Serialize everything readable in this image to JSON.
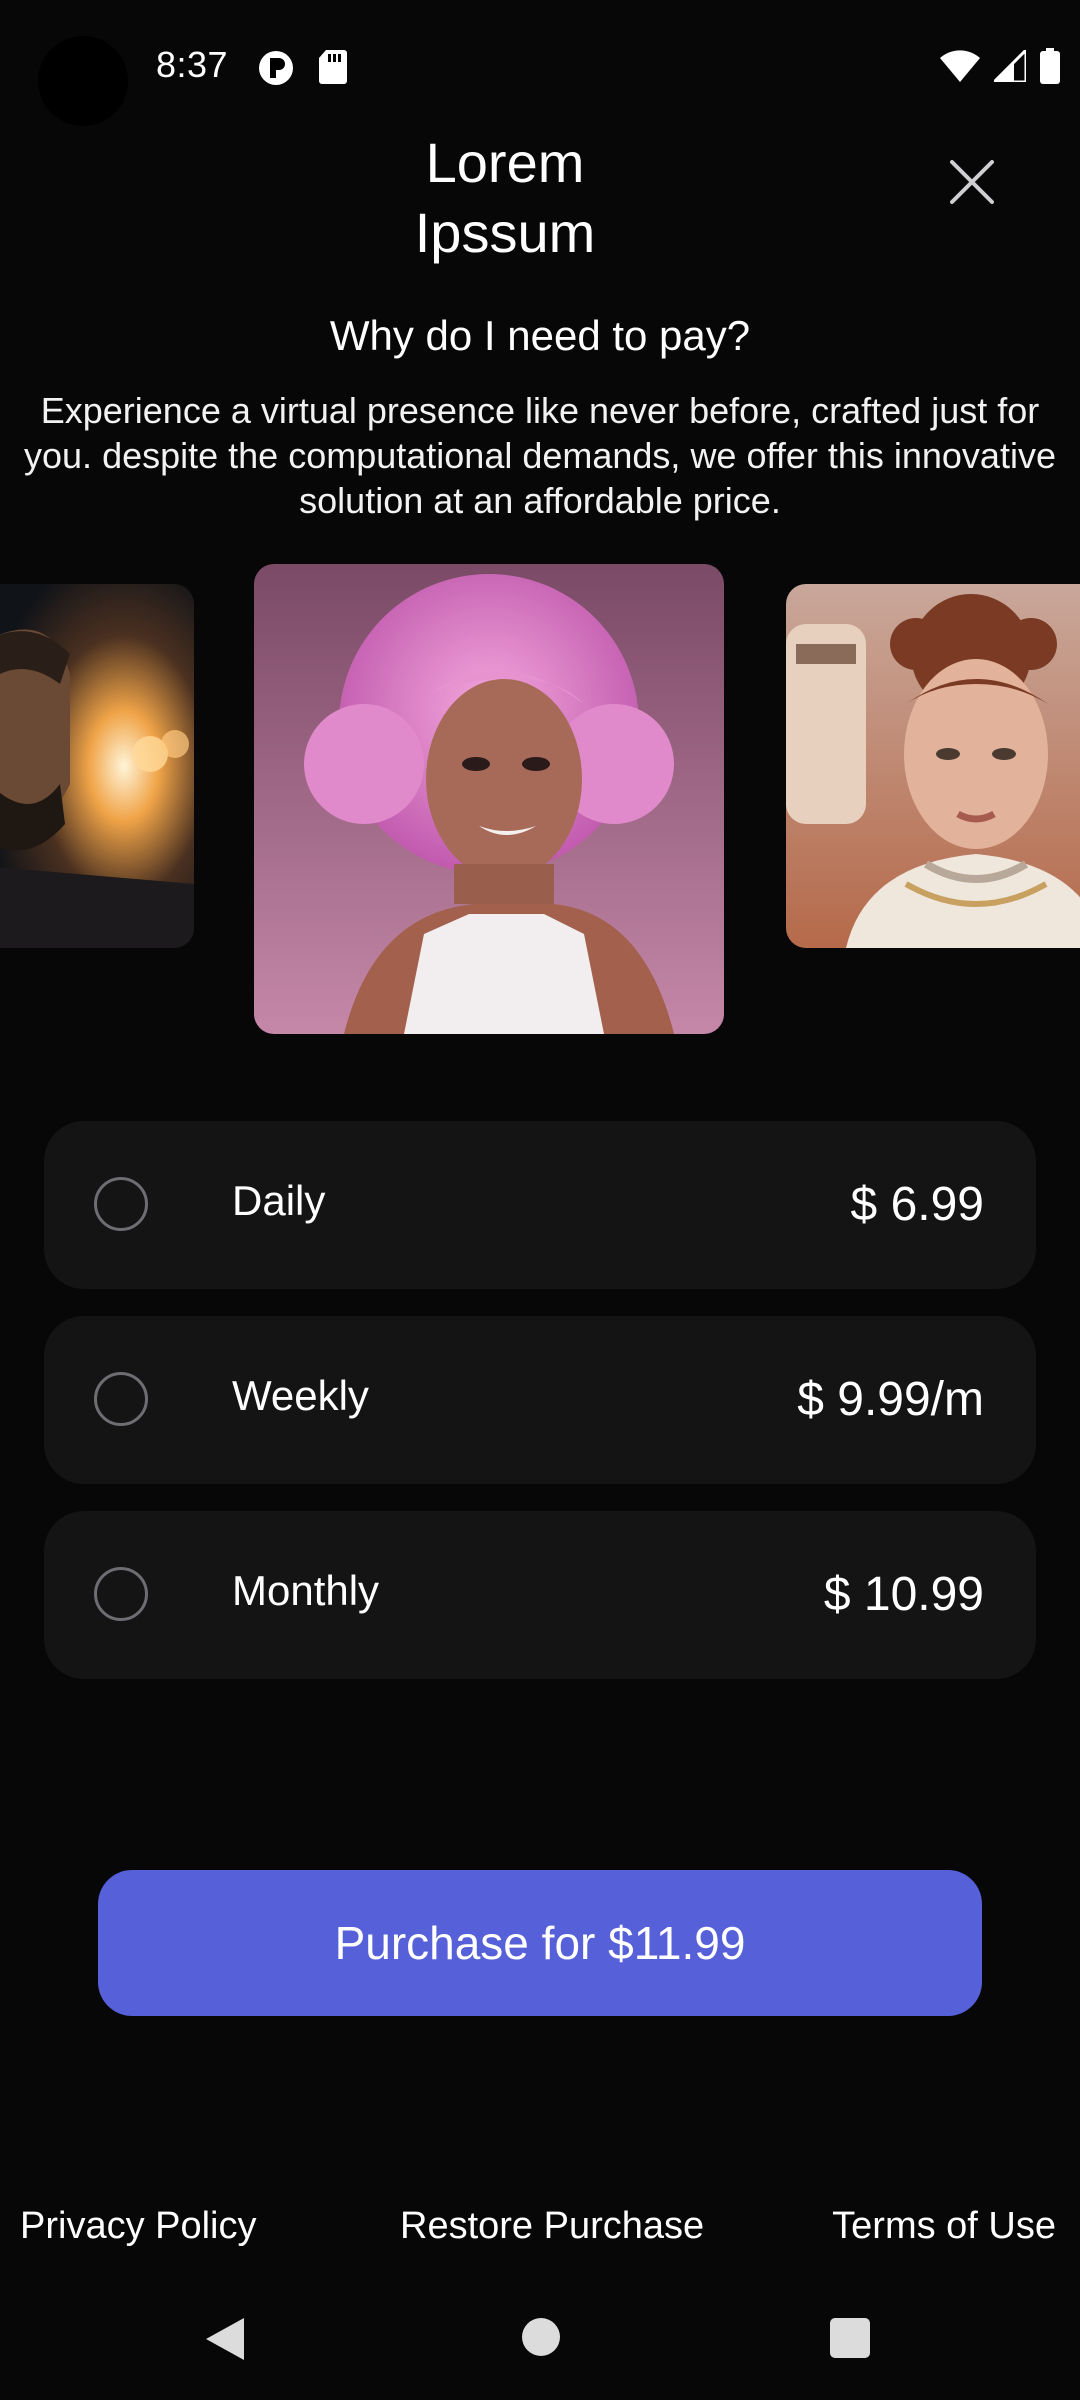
{
  "status_bar": {
    "time": "8:37",
    "icons": [
      "camera-cutout",
      "app-notification-icon",
      "sd-card-icon",
      "wifi-icon",
      "cellular-signal-icon",
      "battery-icon"
    ]
  },
  "header": {
    "title_line1": "Lorem",
    "title_line2": "Ipssum",
    "close_icon": "close-icon"
  },
  "info": {
    "subtitle": "Why do I need to pay?",
    "description": "Experience a virtual presence like never before, crafted just for you. despite the computational demands, we offer this innovative solution at an affordable price."
  },
  "carousel": {
    "items": [
      "avatar-man-portrait",
      "avatar-woman-pink-afro",
      "avatar-woman-astronaut"
    ]
  },
  "plans": [
    {
      "name": "Daily",
      "price": "$ 6.99",
      "selected": false
    },
    {
      "name": "Weekly",
      "price": "$ 9.99/m",
      "selected": false
    },
    {
      "name": "Monthly",
      "price": "$ 10.99",
      "selected": false
    }
  ],
  "purchase": {
    "label": "Purchase for $11.99"
  },
  "footer": {
    "privacy": "Privacy Policy",
    "restore": "Restore Purchase",
    "terms": "Terms of Use"
  },
  "colors": {
    "background": "#070708",
    "card": "#141415",
    "accent": "#5660d8"
  }
}
